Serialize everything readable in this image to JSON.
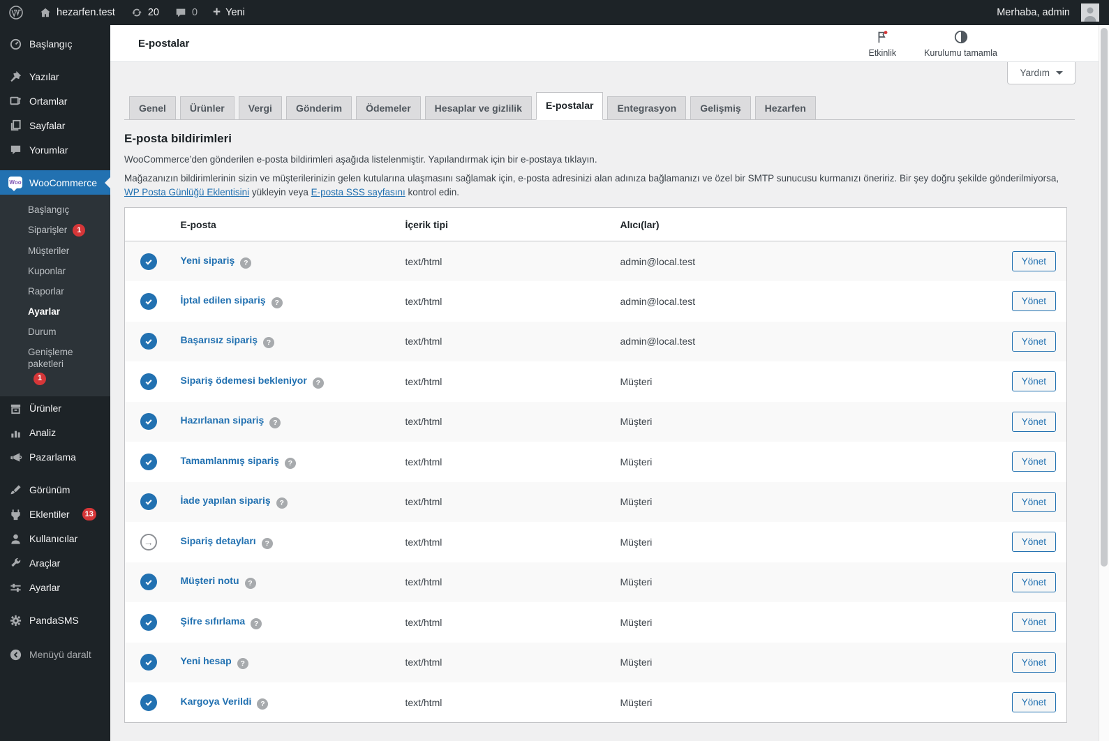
{
  "admin_bar": {
    "site_name": "hezarfen.test",
    "update_count": "20",
    "comment_count": "0",
    "new_label": "Yeni",
    "greeting": "Merhaba, admin"
  },
  "header": {
    "title": "E-postalar",
    "activity_label": "Etkinlik",
    "setup_label": "Kurulumu tamamla",
    "help_label": "Yardım"
  },
  "tabs": {
    "items": [
      "Genel",
      "Ürünler",
      "Vergi",
      "Gönderim",
      "Ödemeler",
      "Hesaplar ve gizlilik",
      "E-postalar",
      "Entegrasyon",
      "Gelişmiş",
      "Hezarfen"
    ],
    "active": "E-postalar"
  },
  "sidebar": {
    "top": [
      {
        "label": "Başlangıç"
      },
      {
        "label": "Yazılar"
      },
      {
        "label": "Ortamlar"
      },
      {
        "label": "Sayfalar"
      },
      {
        "label": "Yorumlar"
      }
    ],
    "woocommerce_label": "WooCommerce",
    "submenu": [
      {
        "label": "Başlangıç"
      },
      {
        "label": "Siparişler",
        "badge": "1"
      },
      {
        "label": "Müşteriler"
      },
      {
        "label": "Kuponlar"
      },
      {
        "label": "Raporlar"
      },
      {
        "label": "Ayarlar",
        "active": true
      },
      {
        "label": "Durum"
      },
      {
        "label": "Genişleme paketleri",
        "badge": "1"
      }
    ],
    "lower": [
      {
        "label": "Ürünler"
      },
      {
        "label": "Analiz"
      },
      {
        "label": "Pazarlama"
      },
      {
        "label": "Görünüm"
      },
      {
        "label": "Eklentiler",
        "badge": "13"
      },
      {
        "label": "Kullanıcılar"
      },
      {
        "label": "Araçlar"
      },
      {
        "label": "Ayarlar"
      },
      {
        "label": "PandaSMS"
      }
    ],
    "collapse_label": "Menüyü daralt"
  },
  "intro": {
    "heading": "E-posta bildirimleri",
    "p1": "WooCommerce’den gönderilen e-posta bildirimleri aşağıda listelenmiştir. Yapılandırmak için bir e-postaya tıklayın.",
    "p2_start": "Mağazanızın bildirimlerinin sizin ve müşterilerinizin gelen kutularına ulaşmasını sağlamak için, e-posta adresinizi alan adınıza bağlamanızı ve özel bir SMTP sunucusu kurmanızı öneririz. Bir şey doğru şekilde gönderilmiyorsa, ",
    "p2_link1": "WP Posta Günlüğü Eklentisini",
    "p2_mid": " yükleyin veya ",
    "p2_link2": "E-posta SSS sayfasını",
    "p2_end": " kontrol edin."
  },
  "table": {
    "headers": {
      "email": "E-posta",
      "content_type": "İçerik tipi",
      "recipients": "Alıcı(lar)"
    },
    "manage_label": "Yönet",
    "rows": [
      {
        "name": "Yeni sipariş",
        "type": "text/html",
        "recipient": "admin@local.test",
        "status": "enabled"
      },
      {
        "name": "İptal edilen sipariş",
        "type": "text/html",
        "recipient": "admin@local.test",
        "status": "enabled"
      },
      {
        "name": "Başarısız sipariş",
        "type": "text/html",
        "recipient": "admin@local.test",
        "status": "enabled"
      },
      {
        "name": "Sipariş ödemesi bekleniyor",
        "type": "text/html",
        "recipient": "Müşteri",
        "status": "enabled"
      },
      {
        "name": "Hazırlanan sipariş",
        "type": "text/html",
        "recipient": "Müşteri",
        "status": "enabled"
      },
      {
        "name": "Tamamlanmış sipariş",
        "type": "text/html",
        "recipient": "Müşteri",
        "status": "enabled"
      },
      {
        "name": "İade yapılan sipariş",
        "type": "text/html",
        "recipient": "Müşteri",
        "status": "enabled"
      },
      {
        "name": "Sipariş detayları",
        "type": "text/html",
        "recipient": "Müşteri",
        "status": "manual"
      },
      {
        "name": "Müşteri notu",
        "type": "text/html",
        "recipient": "Müşteri",
        "status": "enabled"
      },
      {
        "name": "Şifre sıfırlama",
        "type": "text/html",
        "recipient": "Müşteri",
        "status": "enabled"
      },
      {
        "name": "Yeni hesap",
        "type": "text/html",
        "recipient": "Müşteri",
        "status": "enabled"
      },
      {
        "name": "Kargoya Verildi",
        "type": "text/html",
        "recipient": "Müşteri",
        "status": "enabled"
      }
    ]
  },
  "colors": {
    "accent": "#2271b1",
    "badge_red": "#d63638",
    "admin_bar_bg": "#1d2327",
    "page_bg": "#f0f0f1",
    "row_stripe": "#f9f9f9"
  }
}
